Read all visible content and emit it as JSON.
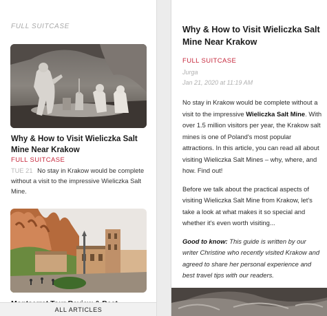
{
  "feed": {
    "source_label": "FULL SUITCASE",
    "bottom_bar_label": "ALL ARTICLES",
    "articles": [
      {
        "title": "Why & How to Visit Wieliczka Salt Mine Near Krakow",
        "source": "FULL SUITCASE",
        "date": "TUE 21",
        "excerpt": "No stay in Krakow would be complete without a visit to the impressive Wieliczka Salt Mine."
      },
      {
        "title": "Montserrat Tour Review & Best Excursions from"
      }
    ]
  },
  "article": {
    "title": "Why & How to Visit Wieliczka Salt Mine Near Krakow",
    "source": "FULL SUITCASE",
    "author": "Jurga",
    "date": "Jan 21, 2020 at 11:19 AM",
    "p1_a": "No stay in Krakow would be complete without a visit to the impressive ",
    "p1_bold": "Wieliczka Salt Mine",
    "p1_b": ". With over 1.5 million visitors per year, the Krakow salt mines is one of Poland's most popular attractions. In this article, you can read all about visiting Wieliczka Salt Mines – why, where, and how. Find out!",
    "p2": "Before we talk about the practical aspects of visiting Wieliczka Salt Mine from Krakow, let's take a look at what makes it so special and whether it's even worth visiting...",
    "p3_bold": "Good to know:",
    "p3_italic": " This guide is written by our writer Christine who recently visited Krakow and agreed to share her personal experience and best travel tips with our readers."
  }
}
